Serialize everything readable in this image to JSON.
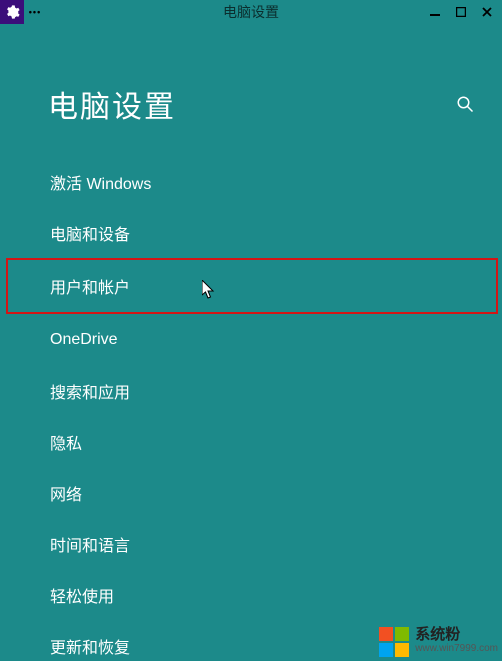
{
  "window": {
    "title": "电脑设置",
    "menu_dots": "•••"
  },
  "page": {
    "title": "电脑设置"
  },
  "menu": {
    "items": [
      {
        "label": "激活 Windows"
      },
      {
        "label": "电脑和设备"
      },
      {
        "label": "用户和帐户"
      },
      {
        "label": "OneDrive"
      },
      {
        "label": "搜索和应用"
      },
      {
        "label": "隐私"
      },
      {
        "label": "网络"
      },
      {
        "label": "时间和语言"
      },
      {
        "label": "轻松使用"
      },
      {
        "label": "更新和恢复"
      }
    ],
    "highlight_index": 2
  },
  "icons": {
    "gear": "gear-icon",
    "search": "search-icon"
  },
  "watermark": {
    "line1": "系统粉",
    "line2": "www.win7999.com"
  }
}
